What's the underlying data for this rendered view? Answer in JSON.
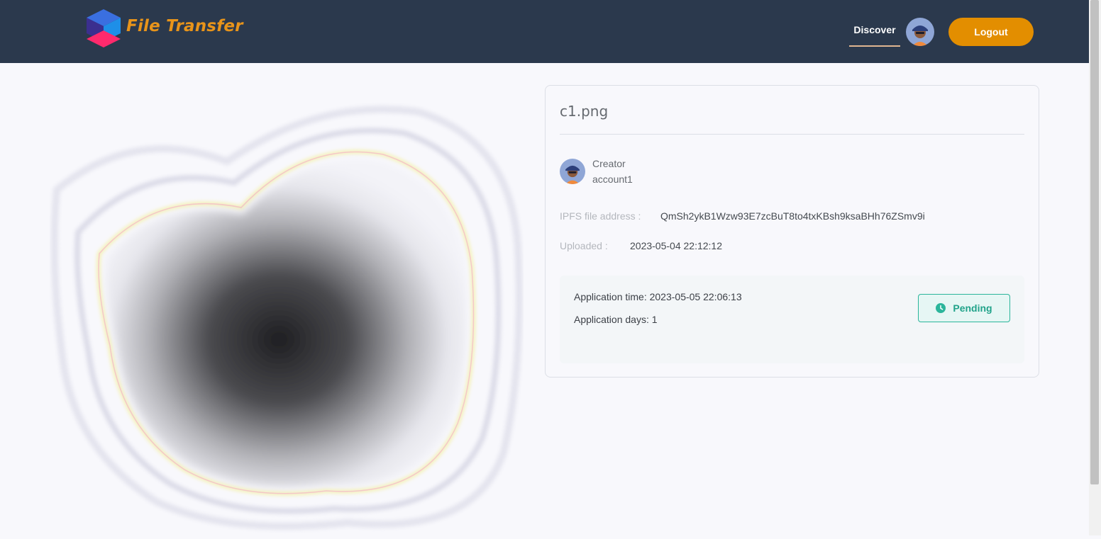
{
  "header": {
    "logo_text": "File Transfer",
    "nav_discover": "Discover",
    "logout_label": "Logout"
  },
  "file": {
    "name": "c1.png",
    "creator_label": "Creator",
    "creator_name": "account1",
    "ipfs_label": "IPFS file address :",
    "ipfs_value": "QmSh2ykB1Wzw93E7zcBuT8to4txKBsh9ksaBHh76ZSmv9i",
    "uploaded_label": "Uploaded :",
    "uploaded_value": "2023-05-04 22:12:12"
  },
  "application": {
    "time_text": "Application time: 2023-05-05 22:06:13",
    "days_text": "Application days: 1",
    "status": "Pending"
  },
  "colors": {
    "navbar_bg": "#2b394d",
    "accent_orange": "#e38e00",
    "status_green": "#2bb59b"
  },
  "icons": {
    "logo": "cube-logo-icon",
    "status": "clock-icon"
  }
}
